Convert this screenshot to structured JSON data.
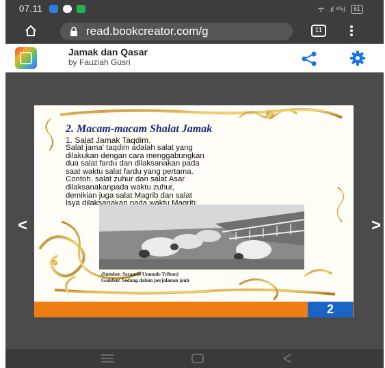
{
  "status_bar": {
    "time": "07.11",
    "signal_text": "·ᯤ· .ıl ⁴ᴳıl",
    "battery": "61",
    "notification_colors": [
      "#2f7de1",
      "#ffffff",
      "#24b34b"
    ]
  },
  "browser": {
    "url": "read.bookcreator.com/g",
    "tab_count": "11",
    "icons": [
      "home-icon",
      "lock-icon",
      "tabs-icon",
      "more-vert-icon"
    ]
  },
  "app_header": {
    "title": "Jamak dan Qasar",
    "author": "by Fauziah Gusri",
    "accent_color": "#1a73e8",
    "icons": [
      "share-icon",
      "gear-icon"
    ]
  },
  "page": {
    "heading": "2. Macam-macam Shalat  Jamak",
    "subheading": "1. Salat Jamak Taqdim.",
    "body_lines": [
      "Salat jama' taqdim adalah salat yang",
      "dilakukan dengan cara menggabungkan",
      "dua salat fardu dan dilaksanakan pada",
      "saat waktu salat fardu yang pertama.",
      "Contoh, salat zuhur dan salat Asar",
      "dilaksanakanpada waktu zuhur,",
      "demikian juga salat Magrib dan salat",
      "Isya dilaksanakan pada waktu Magrib."
    ],
    "caption_source": "(Sumber. Serambi Ummah-Tribun)",
    "caption_text": "Gambar. Sedang dalam perjalanan jauh",
    "page_number": "2",
    "footer_color": "#ee7d14",
    "page_number_bg": "#1a64c8",
    "heading_color": "#1a2a7a"
  },
  "navigation": {
    "prev": "<",
    "next": ">"
  }
}
